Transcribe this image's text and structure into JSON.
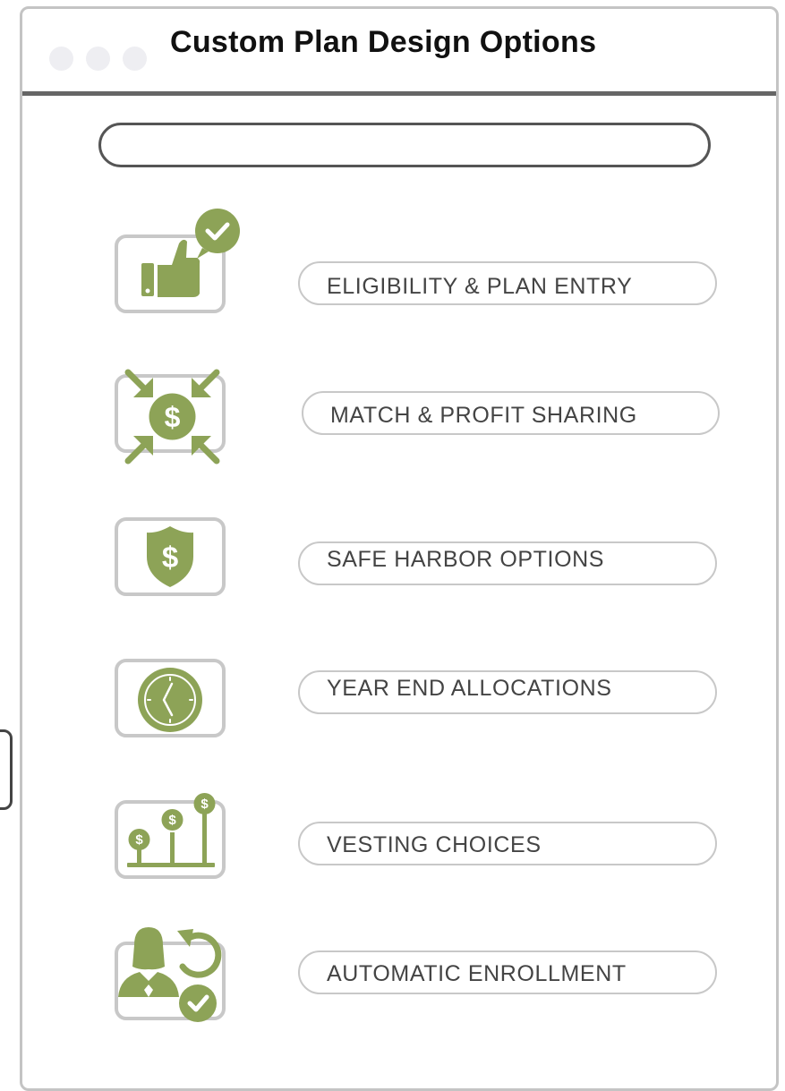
{
  "window": {
    "title": "Custom Plan Design Options",
    "dots": [
      "dot",
      "dot",
      "dot"
    ]
  },
  "search": {
    "value": ""
  },
  "accent_color": "#8da357",
  "options": [
    {
      "label": "ELIGIBILITY & PLAN ENTRY",
      "icon": "thumbs-up-check-icon"
    },
    {
      "label": "MATCH & PROFIT SHARING",
      "icon": "dollar-arrows-icon"
    },
    {
      "label": "SAFE HARBOR OPTIONS",
      "icon": "dollar-shield-icon"
    },
    {
      "label": "YEAR END ALLOCATIONS",
      "icon": "clock-icon"
    },
    {
      "label": "VESTING CHOICES",
      "icon": "dollar-growth-icon"
    },
    {
      "label": "AUTOMATIC ENROLLMENT",
      "icon": "person-refresh-check-icon"
    }
  ]
}
